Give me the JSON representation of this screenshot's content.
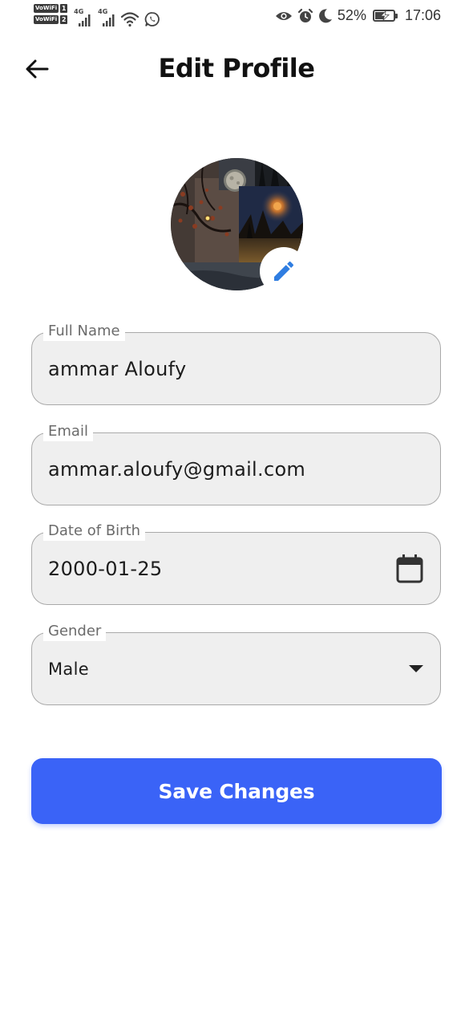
{
  "status_bar": {
    "vowifi_1": "VoWiFi",
    "sim_1": "1",
    "vowifi_2": "VoWiFi",
    "sim_2": "2",
    "net_1": "4G",
    "net_2": "4G",
    "battery_percent": "52%",
    "battery_level": 0.52,
    "time": "17:06",
    "icons": [
      "signal-icon",
      "wifi-icon",
      "whatsapp-icon",
      "eye-icon",
      "alarm-icon",
      "moon-icon",
      "battery-icon"
    ]
  },
  "header": {
    "title": "Edit Profile",
    "back_icon": "arrow-back-icon"
  },
  "avatar": {
    "edit_icon": "pencil-icon",
    "edit_icon_color": "#2f7de1"
  },
  "form": {
    "full_name": {
      "label": "Full Name",
      "value": "ammar Aloufy"
    },
    "email": {
      "label": "Email",
      "value": "ammar.aloufy@gmail.com"
    },
    "date_of_birth": {
      "label": "Date of Birth",
      "value": "2000-01-25",
      "icon": "calendar-icon"
    },
    "gender": {
      "label": "Gender",
      "value": "Male",
      "icon": "dropdown-arrow-icon"
    }
  },
  "actions": {
    "save_label": "Save Changes",
    "save_color": "#3a63f7"
  }
}
